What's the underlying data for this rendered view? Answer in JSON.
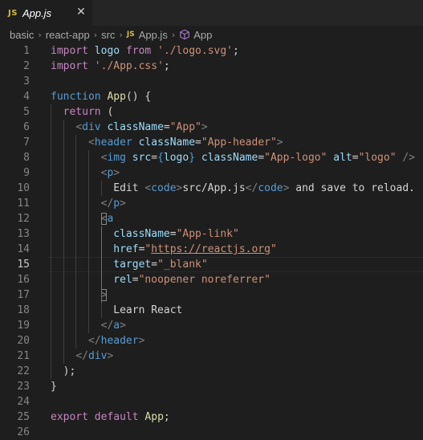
{
  "tab": {
    "badge": "JS",
    "title": "App.js",
    "close": "✕"
  },
  "breadcrumb": {
    "items": [
      "basic",
      "react-app",
      "src"
    ],
    "file_badge": "JS",
    "file": "App.js",
    "symbol": "App",
    "separator": "›"
  },
  "editor": {
    "current_line": 15,
    "line_numbers": [
      "1",
      "2",
      "3",
      "4",
      "5",
      "6",
      "7",
      "8",
      "9",
      "10",
      "11",
      "12",
      "13",
      "14",
      "15",
      "16",
      "17",
      "18",
      "19",
      "20",
      "21",
      "22",
      "23",
      "24",
      "25",
      "26"
    ],
    "lines": [
      [
        [
          "c",
          "import"
        ],
        [
          "w",
          " "
        ],
        [
          "v",
          "logo"
        ],
        [
          "w",
          " "
        ],
        [
          "c",
          "from"
        ],
        [
          "w",
          " "
        ],
        [
          "s",
          "'./logo.svg'"
        ],
        [
          "w",
          ";"
        ]
      ],
      [
        [
          "c",
          "import"
        ],
        [
          "w",
          " "
        ],
        [
          "s",
          "'./App.css'"
        ],
        [
          "w",
          ";"
        ]
      ],
      [],
      [
        [
          "k",
          "function"
        ],
        [
          "w",
          " "
        ],
        [
          "f",
          "App"
        ],
        [
          "w",
          "() {"
        ]
      ],
      [
        [
          "w",
          "  "
        ],
        [
          "c",
          "return"
        ],
        [
          "w",
          " ("
        ]
      ],
      [
        [
          "w",
          "    "
        ],
        [
          "p",
          "<"
        ],
        [
          "t",
          "div"
        ],
        [
          "w",
          " "
        ],
        [
          "v",
          "className"
        ],
        [
          "w",
          "="
        ],
        [
          "s",
          "\"App\""
        ],
        [
          "p",
          ">"
        ]
      ],
      [
        [
          "w",
          "      "
        ],
        [
          "p",
          "<"
        ],
        [
          "t",
          "header"
        ],
        [
          "w",
          " "
        ],
        [
          "v",
          "className"
        ],
        [
          "w",
          "="
        ],
        [
          "s",
          "\"App-header\""
        ],
        [
          "p",
          ">"
        ]
      ],
      [
        [
          "w",
          "        "
        ],
        [
          "p",
          "<"
        ],
        [
          "t",
          "img"
        ],
        [
          "w",
          " "
        ],
        [
          "v",
          "src"
        ],
        [
          "w",
          "="
        ],
        [
          "k",
          "{"
        ],
        [
          "v",
          "logo"
        ],
        [
          "k",
          "}"
        ],
        [
          "w",
          " "
        ],
        [
          "v",
          "className"
        ],
        [
          "w",
          "="
        ],
        [
          "s",
          "\"App-logo\""
        ],
        [
          "w",
          " "
        ],
        [
          "v",
          "alt"
        ],
        [
          "w",
          "="
        ],
        [
          "s",
          "\"logo\""
        ],
        [
          "w",
          " "
        ],
        [
          "p",
          "/>"
        ]
      ],
      [
        [
          "w",
          "        "
        ],
        [
          "p",
          "<"
        ],
        [
          "t",
          "p"
        ],
        [
          "p",
          ">"
        ]
      ],
      [
        [
          "w",
          "          Edit "
        ],
        [
          "p",
          "<"
        ],
        [
          "t",
          "code"
        ],
        [
          "p",
          ">"
        ],
        [
          "w",
          "src/App.js"
        ],
        [
          "p",
          "</"
        ],
        [
          "t",
          "code"
        ],
        [
          "p",
          ">"
        ],
        [
          "w",
          " and save to reload."
        ]
      ],
      [
        [
          "w",
          "        "
        ],
        [
          "p",
          "</"
        ],
        [
          "t",
          "p"
        ],
        [
          "p",
          ">"
        ]
      ],
      [
        [
          "w",
          "        "
        ],
        [
          "pb",
          "<"
        ],
        [
          "t",
          "a"
        ]
      ],
      [
        [
          "w",
          "          "
        ],
        [
          "v",
          "className"
        ],
        [
          "w",
          "="
        ],
        [
          "s",
          "\"App-link\""
        ]
      ],
      [
        [
          "w",
          "          "
        ],
        [
          "v",
          "href"
        ],
        [
          "w",
          "="
        ],
        [
          "s",
          "\""
        ],
        [
          "u",
          "https://reactjs.org"
        ],
        [
          "s",
          "\""
        ]
      ],
      [
        [
          "w",
          "          "
        ],
        [
          "v",
          "target"
        ],
        [
          "w",
          "="
        ],
        [
          "s",
          "\"_blank\""
        ]
      ],
      [
        [
          "w",
          "          "
        ],
        [
          "v",
          "rel"
        ],
        [
          "w",
          "="
        ],
        [
          "s",
          "\"noopener noreferrer\""
        ]
      ],
      [
        [
          "w",
          "        "
        ],
        [
          "pb",
          ">"
        ]
      ],
      [
        [
          "w",
          "          Learn React"
        ]
      ],
      [
        [
          "w",
          "        "
        ],
        [
          "p",
          "</"
        ],
        [
          "t",
          "a"
        ],
        [
          "p",
          ">"
        ]
      ],
      [
        [
          "w",
          "      "
        ],
        [
          "p",
          "</"
        ],
        [
          "t",
          "header"
        ],
        [
          "p",
          ">"
        ]
      ],
      [
        [
          "w",
          "    "
        ],
        [
          "p",
          "</"
        ],
        [
          "t",
          "div"
        ],
        [
          "p",
          ">"
        ]
      ],
      [
        [
          "w",
          "  );"
        ]
      ],
      [
        [
          "w",
          "}"
        ]
      ],
      [],
      [
        [
          "c",
          "export"
        ],
        [
          "w",
          " "
        ],
        [
          "c",
          "default"
        ],
        [
          "w",
          " "
        ],
        [
          "f",
          "App"
        ],
        [
          "w",
          ";"
        ]
      ],
      []
    ]
  },
  "colors": {
    "background": "#1e1e1e",
    "keyword": "#569cd6",
    "control": "#c586c0",
    "string": "#ce9178",
    "attribute": "#9cdcfe",
    "function": "#dcdcaa",
    "js_badge": "#d7ba3d"
  }
}
